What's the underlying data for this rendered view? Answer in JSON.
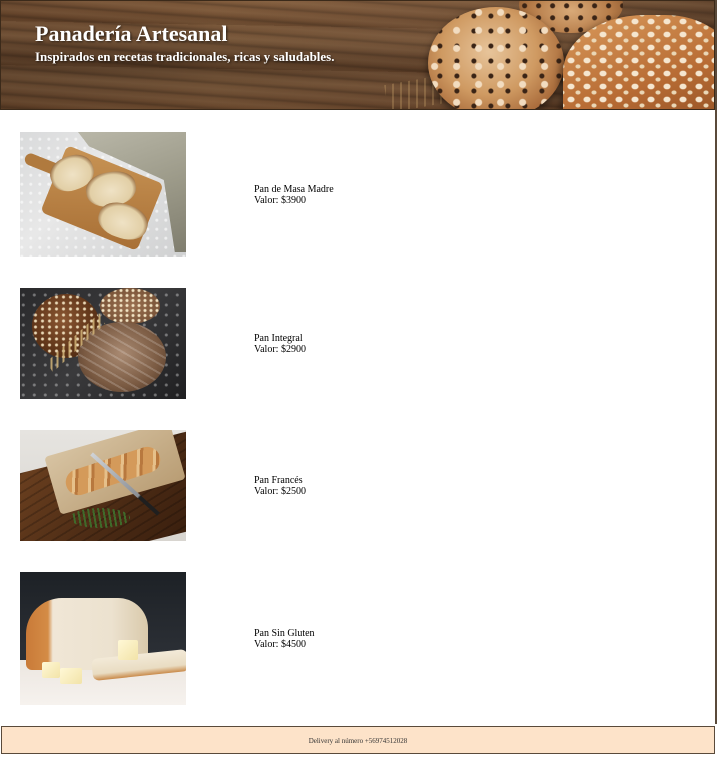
{
  "header": {
    "title": "Panadería Artesanal",
    "subtitle": "Inspirados en recetas tradicionales, ricas y saludables."
  },
  "products": [
    {
      "name": "Pan de Masa Madre",
      "price": "Valor: $3900",
      "image_icon": "sourdough-bread-image"
    },
    {
      "name": "Pan Integral",
      "price": "Valor: $2900",
      "image_icon": "whole-wheat-bread-image"
    },
    {
      "name": "Pan Francés",
      "price": "Valor: $2500",
      "image_icon": "baguette-image"
    },
    {
      "name": "Pan Sin Gluten",
      "price": "Valor: $4500",
      "image_icon": "gluten-free-bread-image"
    }
  ],
  "footer": {
    "text": "Delivery al número +56974512028"
  },
  "colors": {
    "footer_background": "#fde3c9",
    "header_wood": "#6b4a30",
    "text": "#000000"
  }
}
